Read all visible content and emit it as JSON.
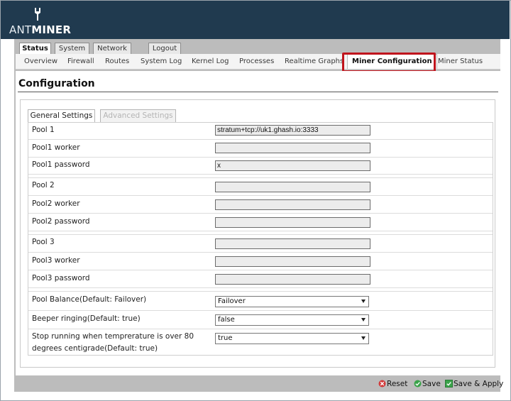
{
  "brand": {
    "light": "ANT",
    "bold": "MINER"
  },
  "top_tabs": [
    {
      "label": "Status",
      "active": true
    },
    {
      "label": "System",
      "active": false
    },
    {
      "label": "Network",
      "active": false
    },
    {
      "label": "Logout",
      "active": false
    }
  ],
  "sub_tabs": [
    {
      "label": "Overview"
    },
    {
      "label": "Firewall"
    },
    {
      "label": "Routes"
    },
    {
      "label": "System Log"
    },
    {
      "label": "Kernel Log"
    },
    {
      "label": "Processes"
    },
    {
      "label": "Realtime Graphs"
    },
    {
      "label": "Miner Configuration",
      "active": true
    },
    {
      "label": "Miner Status"
    }
  ],
  "page": {
    "title": "Configuration"
  },
  "form_tabs": [
    {
      "label": "General Settings",
      "active": true
    },
    {
      "label": "Advanced Settings",
      "active": false
    }
  ],
  "fields": {
    "pool1": {
      "label": "Pool 1",
      "value": "stratum+tcp://uk1.ghash.io:3333"
    },
    "pool1_worker": {
      "label": "Pool1 worker",
      "value": ""
    },
    "pool1_password": {
      "label": "Pool1 password",
      "value": "x"
    },
    "pool2": {
      "label": "Pool 2",
      "value": ""
    },
    "pool2_worker": {
      "label": "Pool2 worker",
      "value": ""
    },
    "pool2_password": {
      "label": "Pool2 password",
      "value": ""
    },
    "pool3": {
      "label": "Pool 3",
      "value": ""
    },
    "pool3_worker": {
      "label": "Pool3 worker",
      "value": ""
    },
    "pool3_password": {
      "label": "Pool3 password",
      "value": ""
    },
    "pool_balance": {
      "label": "Pool Balance(Default: Failover)",
      "value": "Failover"
    },
    "beeper": {
      "label": "Beeper ringing(Default: true)",
      "value": "false"
    },
    "temp_stop": {
      "label_line1": "Stop running when temprerature is over 80",
      "label_line2": "degrees centigrade(Default: true)",
      "value": "true"
    }
  },
  "actions": {
    "reset": "Reset",
    "save": "Save",
    "save_apply": "Save & Apply"
  },
  "colors": {
    "header": "#203a4f",
    "highlight": "#c0141c",
    "reset_icon": "#d23b3b",
    "save_icon": "#3aa34a"
  }
}
